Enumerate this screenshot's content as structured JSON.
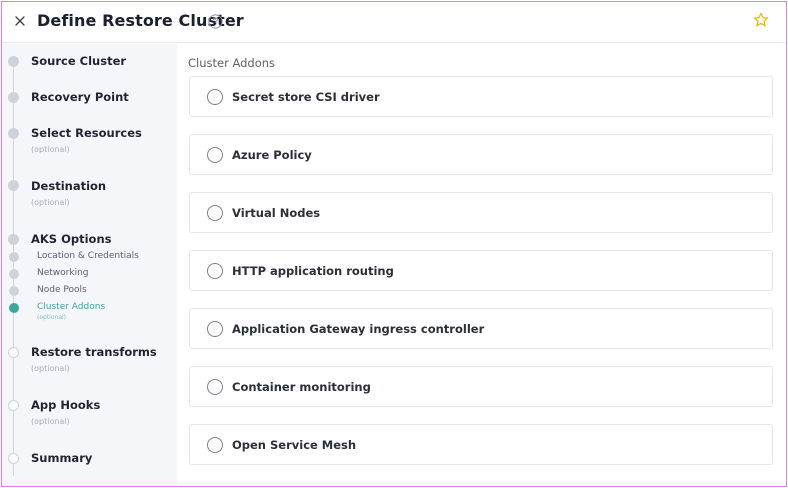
{
  "header": {
    "title": "Define Restore Cluster"
  },
  "icons": {
    "close": "close-icon",
    "help": "help-circle-icon",
    "favorite": "star-icon"
  },
  "colors": {
    "accent": "#3fa59a",
    "star": "#e5b900",
    "border": "#e27be6"
  },
  "sidebar": {
    "steps": [
      {
        "label": "Source Cluster"
      },
      {
        "label": "Recovery Point"
      },
      {
        "label": "Select Resources",
        "sub": "(optional)"
      },
      {
        "label": "Destination",
        "sub": "(optional)"
      },
      {
        "label": "AKS Options",
        "substeps": [
          {
            "label": "Location & Credentials"
          },
          {
            "label": "Networking"
          },
          {
            "label": "Node Pools"
          },
          {
            "label": "Cluster Addons",
            "sub": "(optional)",
            "active": true
          }
        ]
      },
      {
        "label": "Restore transforms",
        "sub": "(optional)"
      },
      {
        "label": "App Hooks",
        "sub": "(optional)"
      },
      {
        "label": "Summary"
      }
    ]
  },
  "main": {
    "section_title": "Cluster Addons",
    "addons": [
      {
        "label": "Secret store CSI driver",
        "checked": false
      },
      {
        "label": "Azure Policy",
        "checked": false
      },
      {
        "label": "Virtual Nodes",
        "checked": false
      },
      {
        "label": "HTTP application routing",
        "checked": false
      },
      {
        "label": "Application Gateway ingress controller",
        "checked": false
      },
      {
        "label": "Container monitoring",
        "checked": false
      },
      {
        "label": "Open Service Mesh",
        "checked": false
      }
    ]
  }
}
